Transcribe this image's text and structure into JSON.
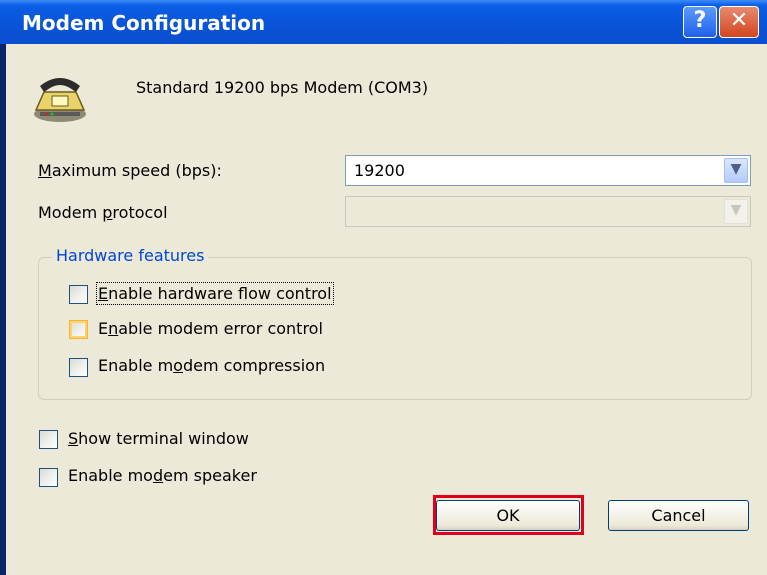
{
  "window": {
    "title": "Modem Configuration",
    "help_glyph": "?",
    "close_glyph": "✕"
  },
  "modem": {
    "name": "Standard 19200 bps Modem (COM3)",
    "icon": "telephone-modem-icon"
  },
  "max_speed": {
    "label_prefix": "",
    "label_accel": "M",
    "label_rest": "aximum speed (bps):",
    "value": "19200"
  },
  "protocol": {
    "label_pre": "Modem ",
    "label_accel": "p",
    "label_post": "rotocol",
    "value": ""
  },
  "hardware": {
    "title": "Hardware features",
    "flow_pre": "",
    "flow_accel": "E",
    "flow_post": "nable hardware flow control",
    "error_pre": "E",
    "error_accel": "n",
    "error_post": "able modem error control",
    "comp_pre": "Enable m",
    "comp_accel": "o",
    "comp_post": "dem compression"
  },
  "terminal": {
    "pre": "",
    "accel": "S",
    "post": "how terminal window"
  },
  "speaker": {
    "pre": "Enable mo",
    "accel": "d",
    "post": "em speaker"
  },
  "buttons": {
    "ok": "OK",
    "cancel": "Cancel"
  },
  "colors": {
    "title_bar": "#0a54d8",
    "client": "#ece9d8",
    "group_title": "#0046d5",
    "highlight": "#e0001c"
  }
}
